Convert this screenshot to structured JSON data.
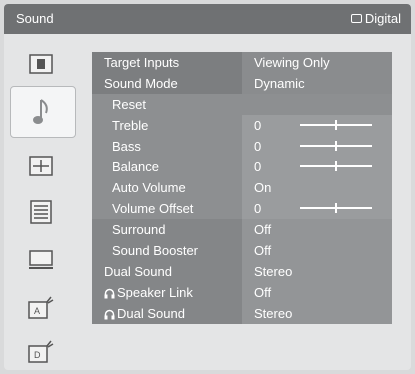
{
  "header": {
    "title": "Sound",
    "source_label": "Digital",
    "source_icon": "tv-screen-icon"
  },
  "sidebar": {
    "items": [
      {
        "name": "picture-icon",
        "selected": false
      },
      {
        "name": "music-note-icon",
        "selected": true
      },
      {
        "name": "screen-grid-icon",
        "selected": false
      },
      {
        "name": "list-settings-icon",
        "selected": false
      },
      {
        "name": "monitor-icon",
        "selected": false
      },
      {
        "name": "antenna-a-icon",
        "selected": false
      },
      {
        "name": "antenna-d-icon",
        "selected": false
      }
    ]
  },
  "menu": {
    "rows": [
      {
        "label": "Target Inputs",
        "value": "Viewing Only"
      },
      {
        "label": "Sound Mode",
        "value": "Dynamic"
      },
      {
        "label": "Reset",
        "value": ""
      },
      {
        "label": "Treble",
        "value": "0",
        "slider": 0.5
      },
      {
        "label": "Bass",
        "value": "0",
        "slider": 0.5
      },
      {
        "label": "Balance",
        "value": "0",
        "slider": 0.5
      },
      {
        "label": "Auto Volume",
        "value": "On"
      },
      {
        "label": "Volume Offset",
        "value": "0",
        "slider": 0.5
      },
      {
        "label": "Surround",
        "value": "Off"
      },
      {
        "label": "Sound Booster",
        "value": "Off"
      },
      {
        "label": "Dual Sound",
        "value": "Stereo"
      },
      {
        "label": "Speaker Link",
        "value": "Off",
        "icon": "headphone-icon"
      },
      {
        "label": "Dual Sound",
        "value": "Stereo",
        "icon": "headphone-icon"
      }
    ]
  },
  "colors": {
    "title_bar": "#6f7173",
    "panel": "#e4e5e6",
    "row": "#8d8f91",
    "text": "#ffffff"
  }
}
